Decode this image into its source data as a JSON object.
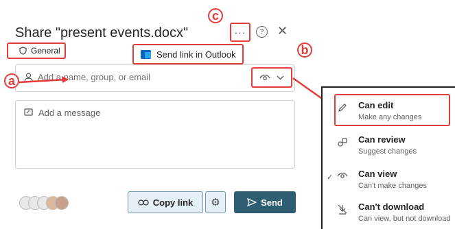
{
  "dialog": {
    "title": "Share \"present events.docx\"",
    "more_label": "···",
    "help_label": "?",
    "close_label": "✕",
    "sensitivity_label": "General",
    "outlook_label": "Send link in Outlook",
    "people_placeholder": "Add a name, group, or email",
    "message_placeholder": "Add a message",
    "copy_link_label": "Copy link",
    "send_label": "Send"
  },
  "callouts": {
    "a": "a",
    "b": "b",
    "c": "c"
  },
  "permissions_menu": {
    "items": [
      {
        "title": "Can edit",
        "subtitle": "Make any changes",
        "icon": "pencil-icon",
        "selected": false
      },
      {
        "title": "Can review",
        "subtitle": "Suggest changes",
        "icon": "review-icon",
        "selected": false
      },
      {
        "title": "Can view",
        "subtitle": "Can't make changes",
        "icon": "eye-icon",
        "selected": true
      },
      {
        "title": "Can't download",
        "subtitle": "Can view, but not download",
        "icon": "no-download-icon",
        "selected": false
      }
    ]
  },
  "colors": {
    "annotation": "#e53b3b",
    "send_button": "#2f5d72",
    "copy_button": "#e5eff6"
  }
}
